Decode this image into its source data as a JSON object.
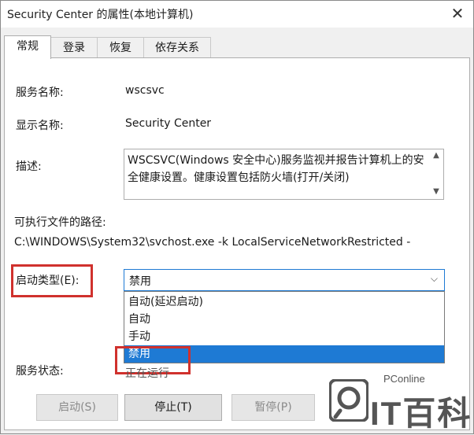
{
  "window": {
    "title": "Security Center 的属性(本地计算机)",
    "close_glyph": "✕"
  },
  "tabs": [
    {
      "label": "常规",
      "active": true
    },
    {
      "label": "登录",
      "active": false
    },
    {
      "label": "恢复",
      "active": false
    },
    {
      "label": "依存关系",
      "active": false
    }
  ],
  "general": {
    "service_name_label": "服务名称:",
    "service_name": "wscsvc",
    "display_name_label": "显示名称:",
    "display_name": "Security Center",
    "description_label": "描述:",
    "description": "WSCSVC(Windows 安全中心)服务监视并报告计算机上的安全健康设置。健康设置包括防火墙(打开/关闭)",
    "exe_path_label": "可执行文件的路径:",
    "exe_path": "C:\\WINDOWS\\System32\\svchost.exe -k LocalServiceNetworkRestricted -",
    "startup_type_label": "启动类型(E):",
    "startup_type_value": "禁用",
    "startup_options": [
      "自动(延迟启动)",
      "自动",
      "手动",
      "禁用"
    ],
    "startup_selected_index": 3,
    "service_status_label": "服务状态:",
    "service_status_value": "正在运行"
  },
  "buttons": {
    "start": "启动(S)",
    "stop": "停止(T)",
    "pause": "暂停(P)"
  },
  "watermark": {
    "small": "PConline",
    "large": "IT百科"
  },
  "colors": {
    "highlight": "#d0312d",
    "selection": "#1e7ad4"
  }
}
